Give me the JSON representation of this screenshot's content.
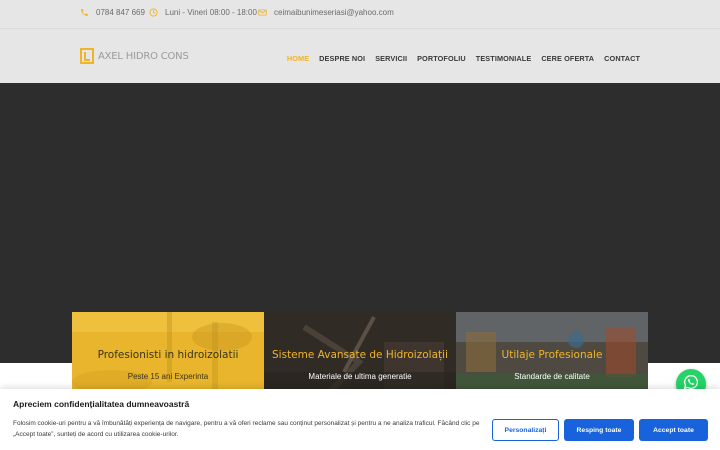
{
  "topbar": {
    "phone": "0784 847 669",
    "hours": "Luni - Vineri 08:00 - 18:00",
    "email": "ceimaibunimeseriasi@yahoo.com",
    "icons": {
      "phone": "phone-icon",
      "clock": "clock-icon",
      "mail": "mail-icon"
    },
    "icon_color": "#f0b429"
  },
  "header": {
    "logo_text": "AXEL HIDRO CONS",
    "nav": [
      {
        "label": "HOME",
        "active": true
      },
      {
        "label": "DESPRE NOI",
        "active": false
      },
      {
        "label": "SERVICII",
        "active": false
      },
      {
        "label": "PORTOFOLIU",
        "active": false
      },
      {
        "label": "TESTIMONIALE",
        "active": false
      },
      {
        "label": "CERE OFERTA",
        "active": false
      },
      {
        "label": "CONTACT",
        "active": false
      }
    ]
  },
  "features": [
    {
      "title": "Profesionisti in hidroizolatii",
      "subtitle": "Peste 15 ani Experinta"
    },
    {
      "title": "Sisteme Avansate de Hidroizolații",
      "subtitle": "Materiale de ultima generatie"
    },
    {
      "title": "Utilaje Profesionale",
      "subtitle": "Standarde de calitate"
    }
  ],
  "whatsapp": {
    "icon": "whatsapp-icon"
  },
  "cookie": {
    "title": "Apreciem confidențialitatea dumneavoastră",
    "text": "Folosim cookie-uri pentru a vă îmbunătăți experiența de navigare, pentru a vă oferi reclame sau conținut personalizat și pentru a ne analiza traficul. Făcând clic pe „Accept toate”, sunteți de acord cu utilizarea cookie-urilor.",
    "customize_label": "Personalizați",
    "reject_label": "Resping toate",
    "accept_label": "Accept toate"
  },
  "colors": {
    "accent": "#f0b429",
    "button_blue": "#1863dc",
    "hero": "#2d2d2d"
  }
}
